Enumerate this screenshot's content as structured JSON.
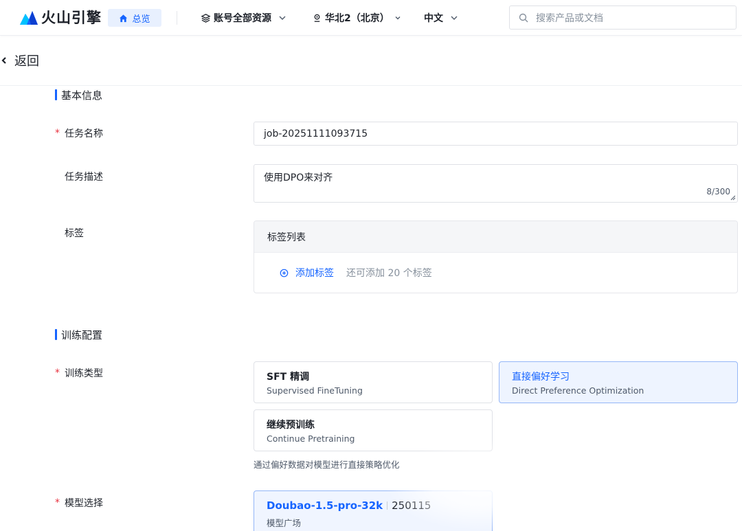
{
  "topbar": {
    "brand": "火山引擎",
    "home_label": "总览",
    "account_label": "账号全部资源",
    "region_label": "华北2（北京）",
    "language_label": "中文",
    "search_placeholder": "搜索产品或文档"
  },
  "back_label": "返回",
  "basic_info": {
    "heading": "基本信息",
    "task_name_label": "任务名称",
    "task_name_value": "job-20251111093715",
    "task_desc_label": "任务描述",
    "task_desc_value": "使用DPO来对齐",
    "task_desc_counter": "8/300",
    "tags_label": "标签",
    "tags_list_header": "标签列表",
    "add_tag_label": "添加标签",
    "tags_remaining_hint": "还可添加 20 个标签"
  },
  "training_config": {
    "heading": "训练配置",
    "training_type_label": "训练类型",
    "types": [
      {
        "title": "SFT 精调",
        "subtitle": "Supervised FineTuning",
        "selected": false
      },
      {
        "title": "直接偏好学习",
        "subtitle": "Direct Preference Optimization",
        "selected": true
      },
      {
        "title": "继续预训练",
        "subtitle": "Continue Pretraining",
        "selected": false
      }
    ],
    "type_hint": "通过偏好数据对模型进行直接策略优化",
    "model_label": "模型选择",
    "model": {
      "name": "Doubao-1.5-pro-32k",
      "version": "250115",
      "source": "模型广场"
    }
  },
  "colors": {
    "accent": "#1664ff",
    "required": "#e8323f"
  }
}
